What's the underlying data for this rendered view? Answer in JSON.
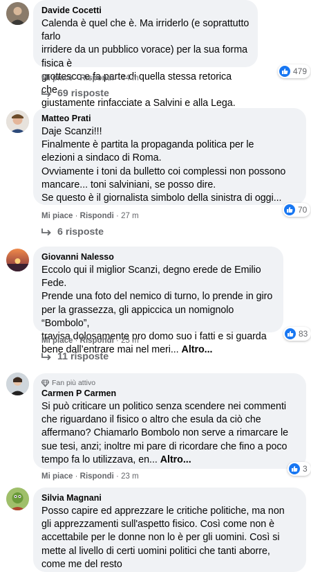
{
  "actions": {
    "like": "Mi piace",
    "reply": "Rispondi",
    "sep": "·"
  },
  "comments": [
    {
      "name": "Davide Cocetti",
      "lines": [
        "Calenda è quel che è. Ma irriderlo (e soprattutto farlo",
        "irridere da un pubblico vorace) per la sua forma fisica è",
        "grottesco e fa parte di quella stessa retorica che",
        "giustamente rinfacciate a Salvini e alla Lega."
      ],
      "time": "44 m",
      "reactions": "479",
      "replies": "69 risposte"
    },
    {
      "name": "Matteo Prati",
      "lines": [
        "Daje Scanzi!!!",
        "Finalmente è partita la propaganda politica per le",
        "elezioni a sindaco di Roma.",
        "Ovviamente i toni da bulletto coi complessi non possono",
        "mancare... toni salviniani, se posso dire.",
        "Se questo è il giornalista simbolo della sinistra di oggi..."
      ],
      "time": "27 m",
      "reactions": "70",
      "replies": "6 risposte"
    },
    {
      "name": "Giovanni Nalesso",
      "lines": [
        "Eccolo qui il miglior Scanzi, degno erede de Emilio Fede.",
        "Prende una foto del nemico di turno, lo prende in giro",
        "per la grassezza, gli appiccica un nomignolo “Bombolo”,",
        "travisa dolosamente pro domo suo i fatti e si guarda",
        "bene dall’entrare mai nel meri..."
      ],
      "more": "Altro...",
      "time": "25 m",
      "reactions": "83",
      "replies": "11 risposte"
    },
    {
      "badge": "Fan più attivo",
      "name": "Carmen P Carmen",
      "lines": [
        "Si può criticare un politico senza scendere nei commenti",
        "che riguardano il fisico o altro che esula da ciò che",
        "affermano? Chiamarlo Bombolo non serve a rimarcare le",
        "sue tesi, anzi; inoltre mi pare di ricordare che fino a poco",
        "tempo fa lo utilizzava, en..."
      ],
      "more": "Altro...",
      "time": "23 m",
      "reactions": "3"
    },
    {
      "name": "Silvia Magnani",
      "lines": [
        "Posso capire ed apprezzare le critiche politiche, ma non",
        "gli apprezzamenti sull'aspetto fisico. Così come non è",
        "accettabile per le donne non lo è per gli uomini. Così si",
        "mette al livello di certi uomini politici che tanti aborre,",
        "come me del resto"
      ]
    }
  ]
}
